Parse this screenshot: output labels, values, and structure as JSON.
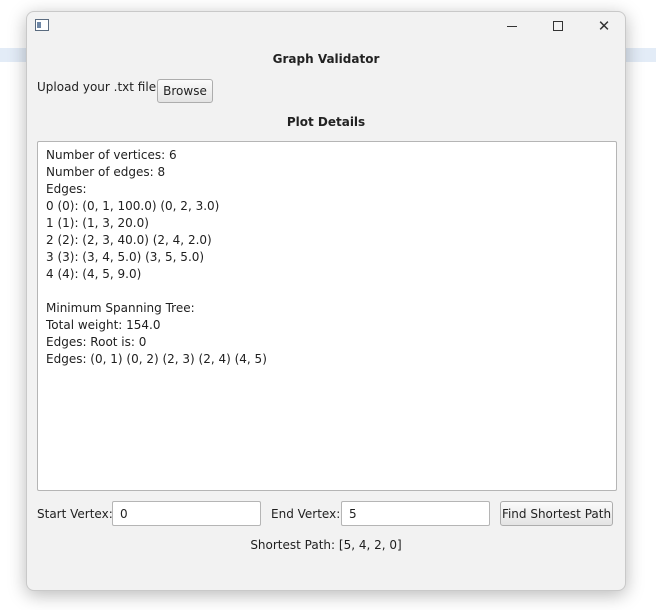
{
  "window": {
    "app_title": "Graph Validator",
    "controls": {
      "minimize": "minimize",
      "maximize": "maximize",
      "close": "close"
    }
  },
  "upload": {
    "label": "Upload your .txt file:",
    "browse_label": "Browse"
  },
  "plot_details": {
    "title": "Plot Details",
    "lines": [
      "Number of vertices: 6",
      "Number of edges: 8",
      "Edges:",
      "0 (0): (0, 1, 100.0) (0, 2, 3.0)",
      "1 (1): (1, 3, 20.0)",
      "2 (2): (2, 3, 40.0) (2, 4, 2.0)",
      "3 (3): (3, 4, 5.0) (3, 5, 5.0)",
      "4 (4): (4, 5, 9.0)",
      "",
      "Minimum Spanning Tree:",
      "Total weight: 154.0",
      "Edges: Root is: 0",
      "Edges: (0, 1) (0, 2) (2, 3) (2, 4) (4, 5)"
    ]
  },
  "path_finder": {
    "start_label": "Start Vertex:",
    "start_value": "0",
    "end_label": "End Vertex:",
    "end_value": "5",
    "find_label": "Find Shortest Path",
    "result_text": "Shortest Path: [5, 4, 2, 0]"
  }
}
